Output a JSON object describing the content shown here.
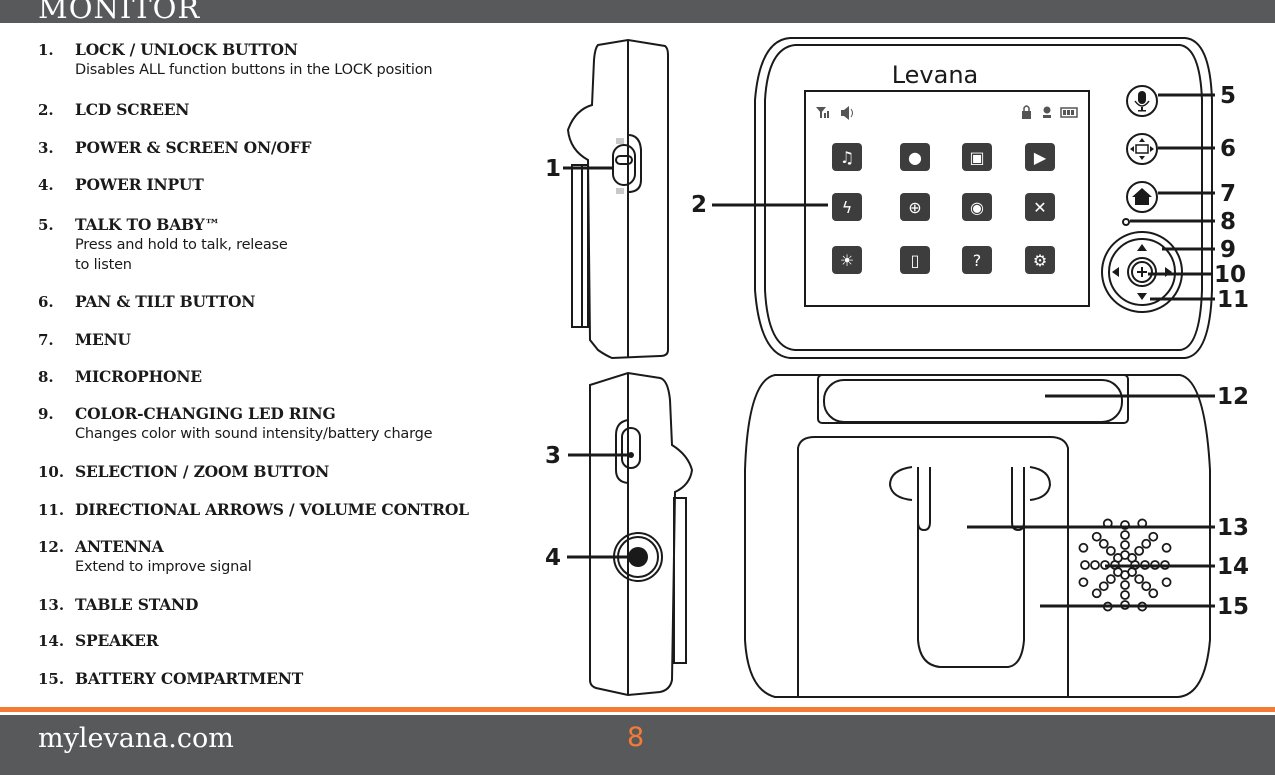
{
  "header": {
    "title": "MONITOR"
  },
  "items": [
    {
      "num": "1.",
      "label": "LOCK / UNLOCK BUTTON",
      "desc": [
        "Disables ALL function buttons in the LOCK position"
      ]
    },
    {
      "num": "2.",
      "label": "LCD SCREEN",
      "desc": []
    },
    {
      "num": "3.",
      "label": "POWER & SCREEN ON/OFF",
      "desc": []
    },
    {
      "num": "4.",
      "label": "POWER INPUT",
      "desc": []
    },
    {
      "num": "5.",
      "label": "TALK TO BABY™",
      "desc": [
        "Press and hold to talk, release",
        "to listen"
      ]
    },
    {
      "num": "6.",
      "label": "PAN & TILT BUTTON",
      "desc": []
    },
    {
      "num": "7.",
      "label": "MENU",
      "desc": []
    },
    {
      "num": "8.",
      "label": "MICROPHONE",
      "desc": []
    },
    {
      "num": "9.",
      "label": "COLOR-CHANGING LED RING",
      "desc": [
        "Changes color with sound intensity/battery charge"
      ]
    },
    {
      "num": "10.",
      "label": "SELECTION / ZOOM BUTTON",
      "desc": []
    },
    {
      "num": "11.",
      "label": "DIRECTIONAL ARROWS / VOLUME CONTROL",
      "desc": []
    },
    {
      "num": "12.",
      "label": "ANTENNA",
      "desc": [
        "Extend to improve signal"
      ]
    },
    {
      "num": "13.",
      "label": "TABLE STAND",
      "desc": []
    },
    {
      "num": "14.",
      "label": "SPEAKER",
      "desc": []
    },
    {
      "num": "15.",
      "label": "BATTERY COMPARTMENT",
      "desc": []
    }
  ],
  "diagram": {
    "brand": "Levana",
    "callouts": [
      "1",
      "2",
      "3",
      "4",
      "5",
      "6",
      "7",
      "8",
      "9",
      "10",
      "11",
      "12",
      "13",
      "14",
      "15"
    ],
    "status_icons": [
      "signal-icon",
      "speaker-volume-icon",
      "lock-icon",
      "camera-1-icon",
      "battery-icon"
    ],
    "menu_icons": [
      "mute-music-icon",
      "camera-snapshot-icon",
      "video-record-icon",
      "playback-icon",
      "power-saving-off-icon",
      "zoom-in-icon",
      "camera-icon",
      "pan-tilt-icon",
      "brightness-icon",
      "pair-camera-icon",
      "help-icon",
      "settings-gear-icon"
    ]
  },
  "footer": {
    "site": "mylevana.com",
    "page": "8"
  },
  "colors": {
    "accent": "#f47b36",
    "bar": "#58595b"
  }
}
